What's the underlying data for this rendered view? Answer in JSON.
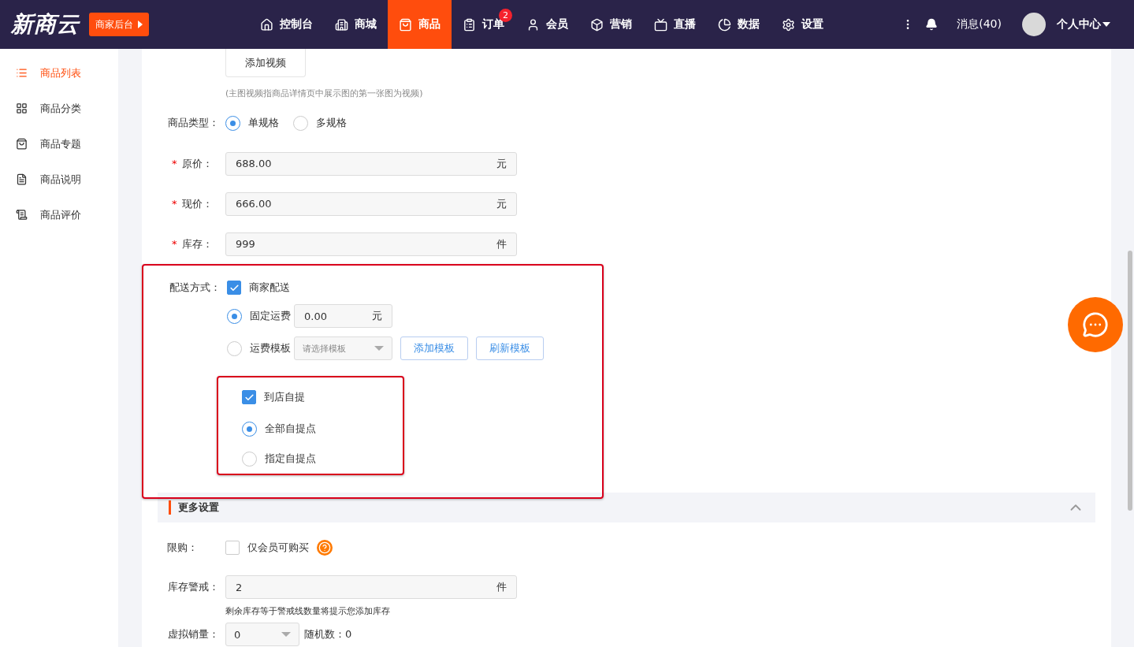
{
  "nav": {
    "logo": "新商云",
    "backend_button": "商家后台",
    "items": [
      {
        "label": "控制台",
        "selected": false
      },
      {
        "label": "商城",
        "selected": false
      },
      {
        "label": "商品",
        "selected": true
      },
      {
        "label": "订单",
        "selected": false,
        "badge": "2"
      },
      {
        "label": "会员",
        "selected": false
      },
      {
        "label": "营销",
        "selected": false
      },
      {
        "label": "直播",
        "selected": false
      },
      {
        "label": "数据",
        "selected": false
      },
      {
        "label": "设置",
        "selected": false
      }
    ],
    "messages": "消息(40)",
    "user": "个人中心"
  },
  "sidebar": {
    "items": [
      {
        "label": "商品列表",
        "selected": true
      },
      {
        "label": "商品分类",
        "selected": false
      },
      {
        "label": "商品专题",
        "selected": false
      },
      {
        "label": "商品说明",
        "selected": false
      },
      {
        "label": "商品评价",
        "selected": false
      }
    ]
  },
  "form": {
    "video_button": "添加视频",
    "video_hint": "(主图视频指商品详情页中展示图的第一张图为视频)",
    "product_type": {
      "label": "商品类型：",
      "options": [
        {
          "label": "单规格",
          "selected": true
        },
        {
          "label": "多规格",
          "selected": false
        }
      ]
    },
    "fields": [
      {
        "label": "原价：",
        "required_mark": "*",
        "value": "688.00",
        "unit": "元"
      },
      {
        "label": "现价：",
        "required_mark": "*",
        "value": "666.00",
        "unit": "元"
      },
      {
        "label": "库存：",
        "required_mark": "*",
        "value": "999",
        "unit": "件"
      }
    ],
    "delivery": {
      "label": "配送方式：",
      "merchant": {
        "label": "商家配送",
        "checked": true
      },
      "fixed": {
        "label": "固定运费",
        "selected": true,
        "value": "0.00",
        "unit": "元"
      },
      "template": {
        "label": "运费模板",
        "selected": false,
        "placeholder": "请选择模板",
        "buttons": [
          "添加模板",
          "刷新模板"
        ]
      },
      "pickup": {
        "label": "到店自提",
        "checked": true
      },
      "pickup_options": [
        {
          "label": "全部自提点",
          "selected": true
        },
        {
          "label": "指定自提点",
          "selected": false
        }
      ]
    },
    "more_settings": {
      "title": "更多设置",
      "expanded": true
    },
    "limit": {
      "label": "限购：",
      "option": {
        "label": "仅会员可购买",
        "checked": false
      }
    },
    "stock_alert": {
      "label": "库存警戒：",
      "value": "2",
      "unit": "件",
      "hint": "剩余库存等于警戒线数量将提示您添加库存"
    },
    "virtual_sales": {
      "label": "虚拟销量：",
      "value": "0",
      "random": "随机数：0"
    }
  }
}
